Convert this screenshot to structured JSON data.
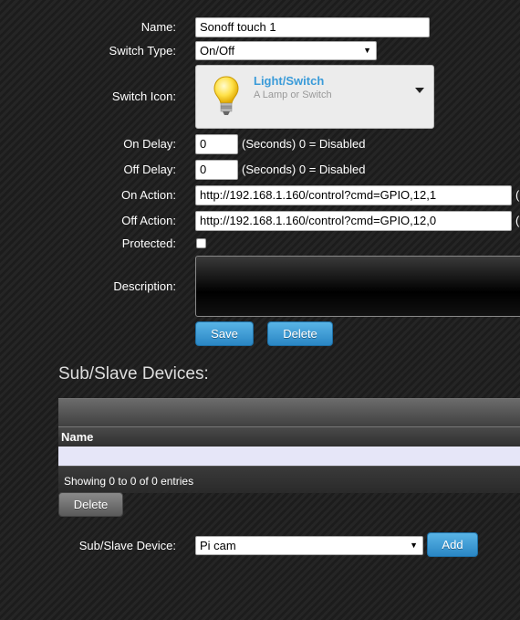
{
  "form": {
    "name_label": "Name:",
    "name_value": "Sonoff touch 1",
    "switch_type_label": "Switch Type:",
    "switch_type_value": "On/Off",
    "switch_icon_label": "Switch Icon:",
    "icon_title": "Light/Switch",
    "icon_subtitle": "A Lamp or Switch",
    "icon_semantic": "lightbulb-icon",
    "on_delay_label": "On Delay:",
    "on_delay_value": "0",
    "on_delay_note": "(Seconds) 0 = Disabled",
    "off_delay_label": "Off Delay:",
    "off_delay_value": "0",
    "off_delay_note": "(Seconds) 0 = Disabled",
    "on_action_label": "On Action:",
    "on_action_value": "http://192.168.1.160/control?cmd=GPIO,12,1",
    "off_action_label": "Off Action:",
    "off_action_value": "http://192.168.1.160/control?cmd=GPIO,12,0",
    "protected_label": "Protected:",
    "protected_checked": false,
    "description_label": "Description:",
    "description_value": "",
    "save_label": "Save",
    "delete_label": "Delete"
  },
  "subslave": {
    "title": "Sub/Slave Devices:",
    "columns": [
      "Name"
    ],
    "rows": [],
    "footer": "Showing 0 to 0 of 0 entries",
    "delete_label": "Delete",
    "device_label": "Sub/Slave Device:",
    "device_value": "Pi cam",
    "add_label": "Add"
  },
  "colors": {
    "accent": "#3a9bd9",
    "button_blue": "#2a86c4",
    "background": "#1e1e1e"
  }
}
